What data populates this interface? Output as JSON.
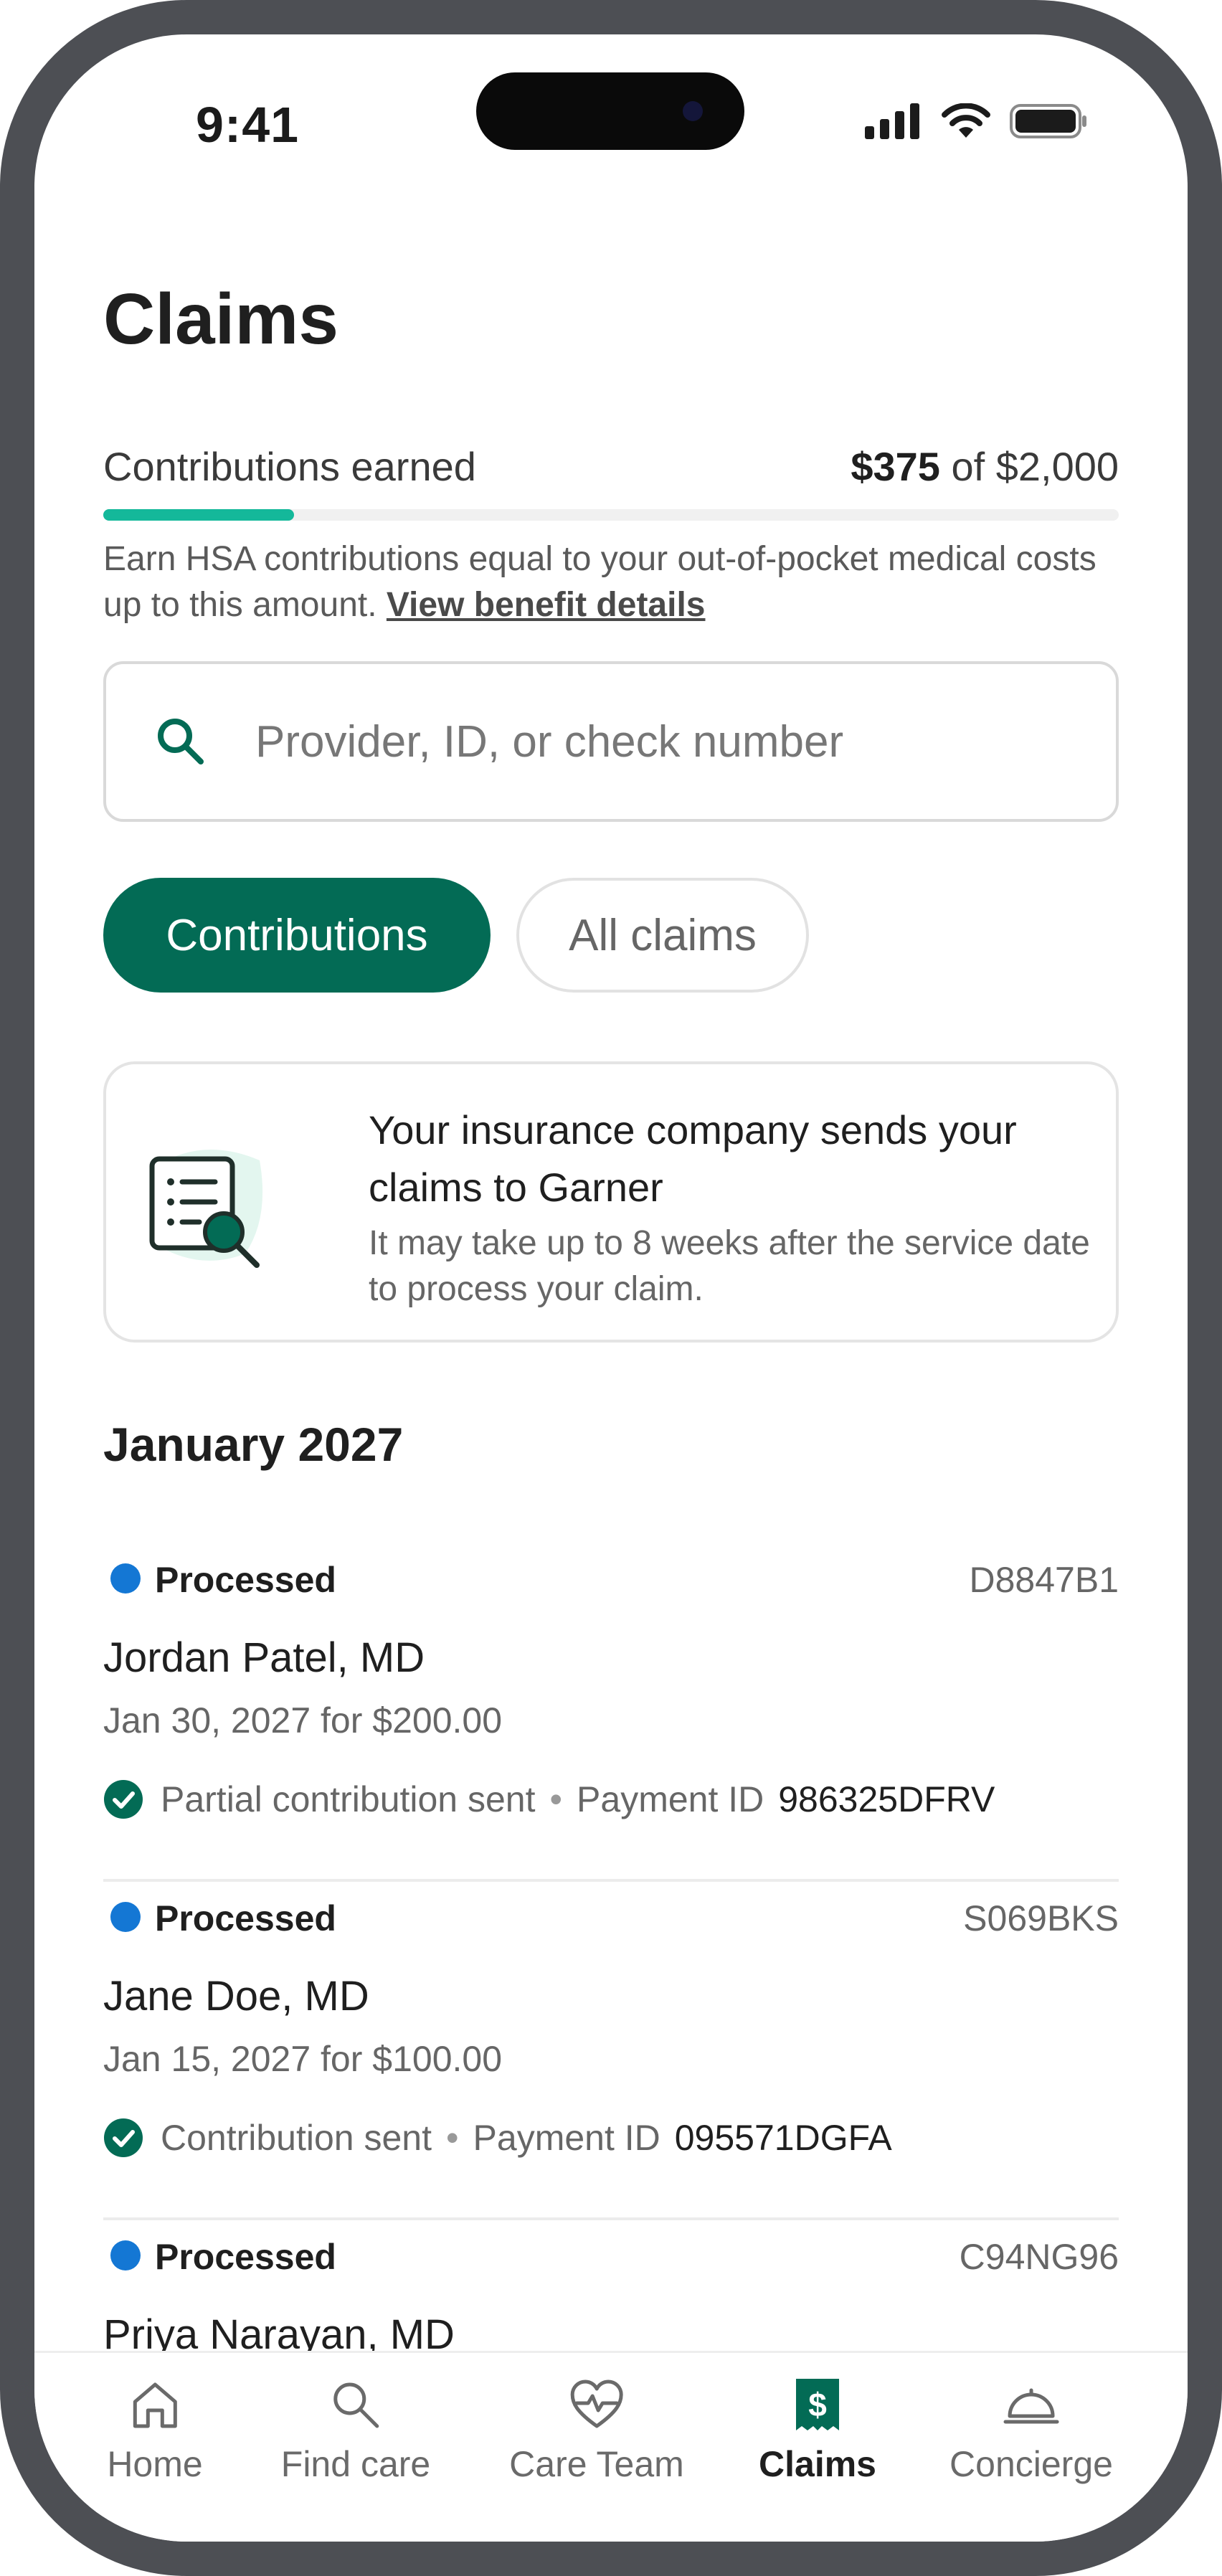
{
  "status_bar": {
    "time": "9:41"
  },
  "page": {
    "title": "Claims"
  },
  "contributions": {
    "label": "Contributions earned",
    "earned": "$375",
    "of_text": "of $2,000",
    "progress_fraction": 0.1875,
    "hint": "Earn HSA contributions equal to your out-of-pocket medical costs up to this amount.",
    "link": "View benefit details",
    "accent": "#14b89a"
  },
  "search": {
    "placeholder": "Provider, ID, or check number"
  },
  "filters": {
    "contributions": "Contributions",
    "all_claims": "All claims",
    "active_color": "#036b55"
  },
  "info_card": {
    "heading": "Your insurance company sends your claims to Garner",
    "body": "It may take up to 8 weeks after the service date to process your claim.",
    "icon": "claims-document-search-icon"
  },
  "month": "January 2027",
  "claims": [
    {
      "status": "Processed",
      "id": "D8847B1",
      "provider": "Jordan Patel, MD",
      "date": "Jan 30, 2027 for $200.00",
      "contribution": "Partial contribution sent",
      "payment_label": "Payment ID",
      "payment_id": "986325DFRV"
    },
    {
      "status": "Processed",
      "id": "S069BKS",
      "provider": "Jane Doe, MD",
      "date": "Jan 15, 2027 for $100.00",
      "contribution": "Contribution sent",
      "payment_label": "Payment ID",
      "payment_id": "095571DGFA"
    },
    {
      "status": "Processed",
      "id": "C94NG96",
      "provider": "Priya Narayan, MD"
    }
  ],
  "separator": "•",
  "status_color": "#1477d4",
  "tabs": [
    {
      "label": "Home",
      "icon": "home-icon"
    },
    {
      "label": "Find care",
      "icon": "search-icon"
    },
    {
      "label": "Care Team",
      "icon": "heart-pulse-icon"
    },
    {
      "label": "Claims",
      "icon": "dollar-receipt-icon",
      "active": true
    },
    {
      "label": "Concierge",
      "icon": "service-bell-icon"
    }
  ]
}
